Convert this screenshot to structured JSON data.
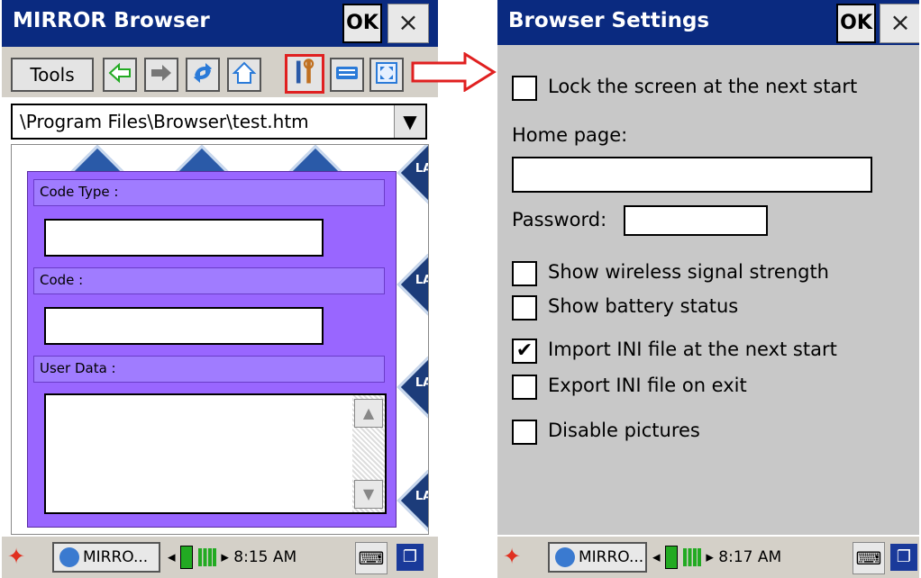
{
  "left": {
    "title": "MIRROR Browser",
    "ok_label": "OK",
    "close_label": "×",
    "tools_label": "Tools",
    "address": "\\Program Files\\Browser\\test.htm",
    "form": {
      "code_type_label": "Code Type :",
      "code_label": "Code :",
      "user_data_label": "User Data :"
    },
    "taskbar": {
      "app_label": "MIRRO...",
      "time": "8:15 AM"
    }
  },
  "right": {
    "title": "Browser Settings",
    "ok_label": "OK",
    "close_label": "×",
    "options": {
      "lock": {
        "label": "Lock the screen at the next start",
        "checked": false
      },
      "home_page_label": "Home page:",
      "password_label": "Password:",
      "wireless": {
        "label": "Show wireless signal strength",
        "checked": false
      },
      "battery": {
        "label": "Show battery status",
        "checked": false
      },
      "import_ini": {
        "label": "Import INI file at the next start",
        "checked": true
      },
      "export_ini": {
        "label": "Export INI file on exit",
        "checked": false
      },
      "disable_pictures": {
        "label": "Disable pictures",
        "checked": false
      }
    },
    "taskbar": {
      "app_label": "MIRRO...",
      "time": "8:17 AM"
    }
  },
  "logos": {
    "lab_text": "LAB"
  },
  "colors": {
    "title_bar": "#0a2a80",
    "form_bg": "#9966ff",
    "highlight": "#e02020",
    "arrow": "#e02020"
  }
}
